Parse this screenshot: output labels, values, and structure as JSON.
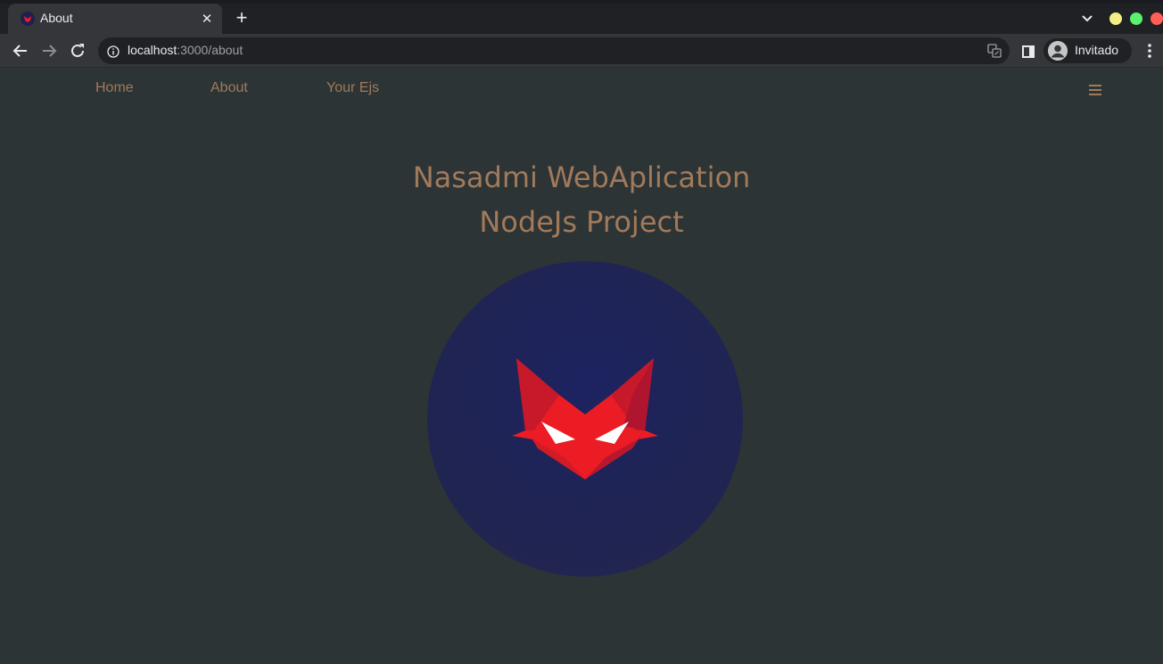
{
  "browser": {
    "tab_title": "About",
    "tab_close": "✕",
    "new_tab": "+",
    "url_host": "localhost",
    "url_path": ":3000/about",
    "profile_label": "Invitado"
  },
  "nav": {
    "home": "Home",
    "about": "About",
    "your_ejs": "Your Ejs"
  },
  "hero": {
    "title_line1": "Nasadmi WebAplication",
    "title_line2": "NodeJs Project"
  },
  "colors": {
    "page_bg": "#2d3436",
    "accent_text": "#a17a5a",
    "logo_circle": "#1c2360",
    "logo_red": "#ec1c24"
  },
  "icons": [
    "back-arrow-icon",
    "forward-arrow-icon",
    "reload-icon",
    "info-icon",
    "translate-icon",
    "side-panel-icon",
    "profile-avatar-icon",
    "more-vert-icon",
    "hamburger-menu-icon",
    "fox-logo-icon"
  ]
}
